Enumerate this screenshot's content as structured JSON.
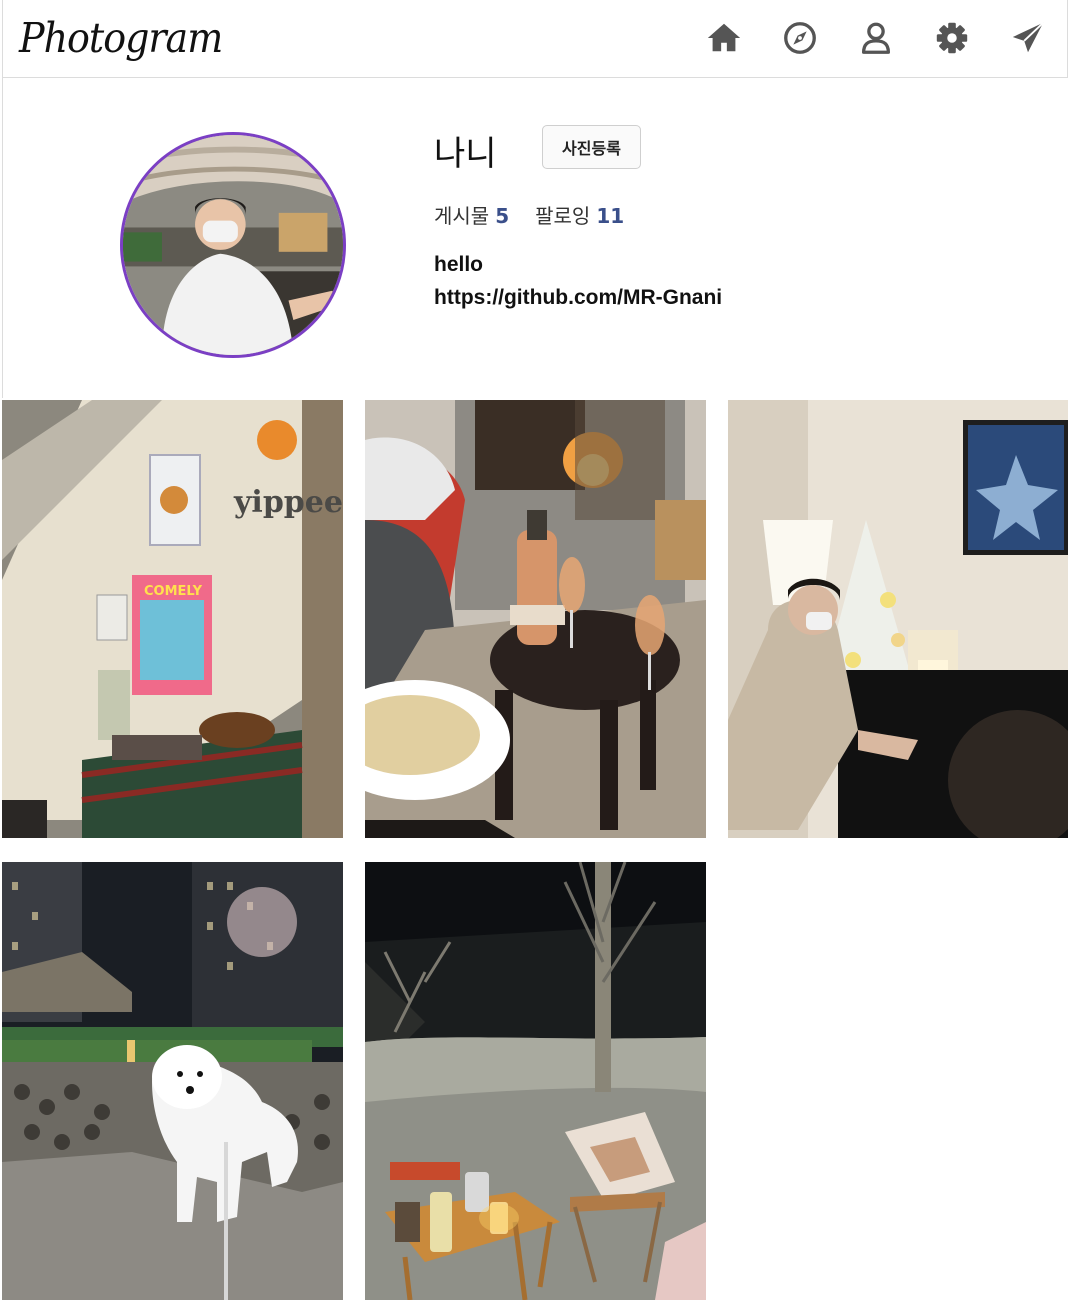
{
  "app": {
    "logo": "Photogram"
  },
  "nav": [
    {
      "id": "home",
      "icon": "home-icon"
    },
    {
      "id": "explore",
      "icon": "compass-icon"
    },
    {
      "id": "profile",
      "icon": "user-icon"
    },
    {
      "id": "settings",
      "icon": "gear-icon"
    },
    {
      "id": "direct",
      "icon": "paper-plane-icon"
    }
  ],
  "profile": {
    "username": "나니",
    "upload_label": "사진등록",
    "posts_label": "게시물",
    "posts_count": "5",
    "following_label": "팔로잉",
    "following_count": "11",
    "bio_line1": "hello",
    "bio_line2": "https://github.com/MR-Gnani",
    "avatar_ring_color": "#7b3fc4"
  },
  "photos": [
    {
      "name": "cafe-wall-photo"
    },
    {
      "name": "fireplace-wine-photo"
    },
    {
      "name": "piano-christmas-photo"
    },
    {
      "name": "white-dog-night-photo"
    },
    {
      "name": "camping-night-photo"
    }
  ],
  "colors": {
    "accent_blue": "#3a4f8a",
    "header_border": "#dcdcdc",
    "icon_gray": "#555555"
  }
}
